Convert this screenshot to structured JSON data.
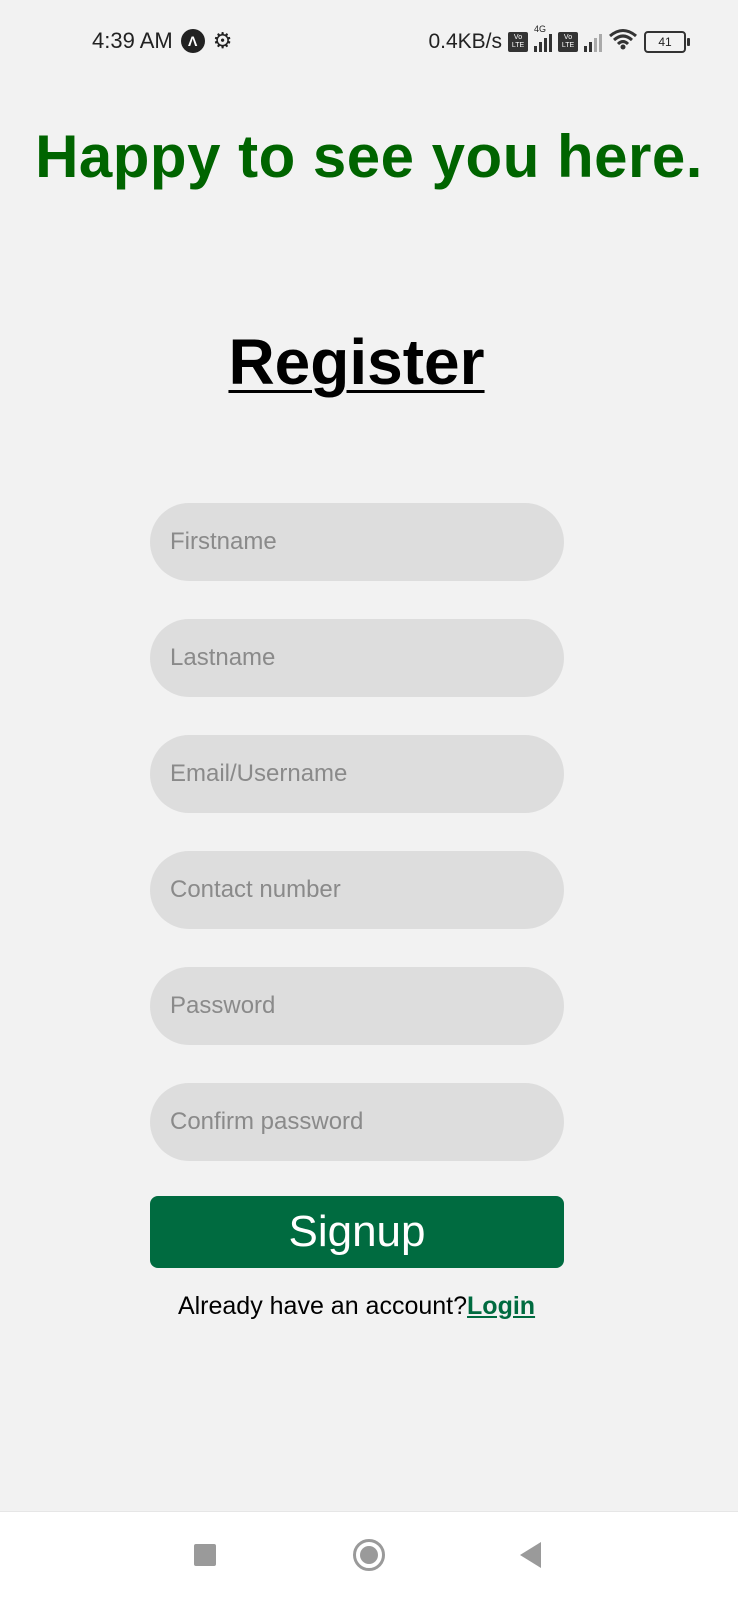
{
  "status_bar": {
    "time": "4:39 AM",
    "network_speed": "0.4KB/s",
    "network_type": "4G",
    "volte_label": "Vo LTE",
    "battery": "41",
    "icons": [
      "app-icon",
      "gear-icon",
      "volte-icon",
      "signal-icon",
      "volte-icon",
      "signal-icon",
      "wifi-icon",
      "battery-icon"
    ]
  },
  "header": {
    "headline": "Happy to see you here.",
    "headline_color": "#006400"
  },
  "form": {
    "title": "Register",
    "fields": [
      {
        "name": "firstname",
        "placeholder": "Firstname",
        "value": ""
      },
      {
        "name": "lastname",
        "placeholder": "Lastname",
        "value": ""
      },
      {
        "name": "email",
        "placeholder": "Email/Username",
        "value": ""
      },
      {
        "name": "contact",
        "placeholder": "Contact number",
        "value": ""
      },
      {
        "name": "password",
        "placeholder": "Password",
        "value": ""
      },
      {
        "name": "confirm",
        "placeholder": "Confirm password",
        "value": ""
      }
    ],
    "submit_label": "Signup",
    "submit_color": "#006b40",
    "login_prompt": "Already have an account?",
    "login_link": "Login"
  },
  "nav_bar": {
    "buttons": [
      "recents-square-icon",
      "home-circle-icon",
      "back-triangle-icon"
    ]
  }
}
